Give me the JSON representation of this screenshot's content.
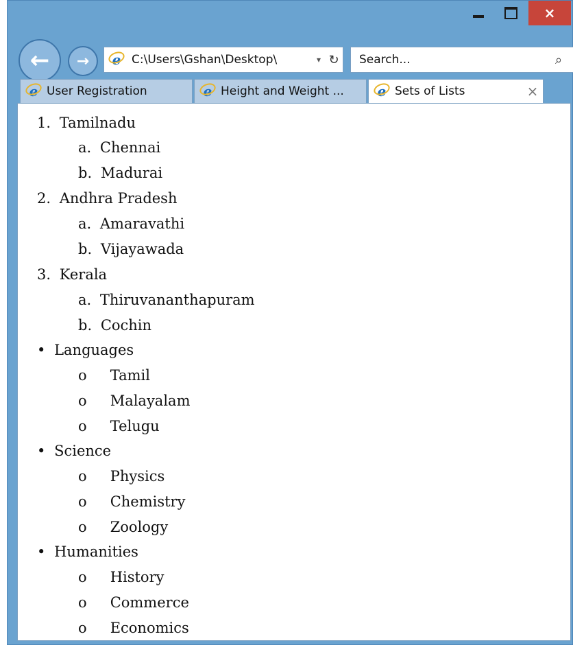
{
  "window": {
    "close_glyph": "×"
  },
  "nav": {
    "back_glyph": "←",
    "forward_glyph": "→",
    "address": "C:\\Users\\Gshan\\Desktop\\",
    "address_dropdown_glyph": "▾",
    "refresh_glyph": "↻",
    "search_placeholder": "Search...",
    "search_glyph": "⌕"
  },
  "tabs": [
    {
      "label": "User Registration",
      "active": false
    },
    {
      "label": "Height and Weight ...",
      "active": false
    },
    {
      "label": "Sets of Lists",
      "active": true,
      "close": "×"
    }
  ],
  "content": {
    "ordered": [
      {
        "marker": "1.",
        "text": "Tamilnadu",
        "children": [
          {
            "marker": "a.",
            "text": "Chennai"
          },
          {
            "marker": "b.",
            "text": "Madurai"
          }
        ]
      },
      {
        "marker": "2.",
        "text": "Andhra Pradesh",
        "children": [
          {
            "marker": "a.",
            "text": "Amaravathi"
          },
          {
            "marker": "b.",
            "text": "Vijayawada"
          }
        ]
      },
      {
        "marker": "3.",
        "text": "Kerala",
        "children": [
          {
            "marker": "a.",
            "text": "Thiruvananthapuram"
          },
          {
            "marker": "b.",
            "text": "Cochin"
          }
        ]
      }
    ],
    "unordered": [
      {
        "marker": "•",
        "text": "Languages",
        "children": [
          {
            "marker": "o",
            "text": "Tamil"
          },
          {
            "marker": "o",
            "text": "Malayalam"
          },
          {
            "marker": "o",
            "text": "Telugu"
          }
        ]
      },
      {
        "marker": "•",
        "text": "Science",
        "children": [
          {
            "marker": "o",
            "text": " Physics"
          },
          {
            "marker": "o",
            "text": "Chemistry"
          },
          {
            "marker": "o",
            "text": "Zoology"
          }
        ]
      },
      {
        "marker": "•",
        "text": "Humanities",
        "children": [
          {
            "marker": "o",
            "text": " History"
          },
          {
            "marker": "o",
            "text": "Commerce"
          },
          {
            "marker": "o",
            "text": "Economics"
          }
        ]
      }
    ]
  }
}
